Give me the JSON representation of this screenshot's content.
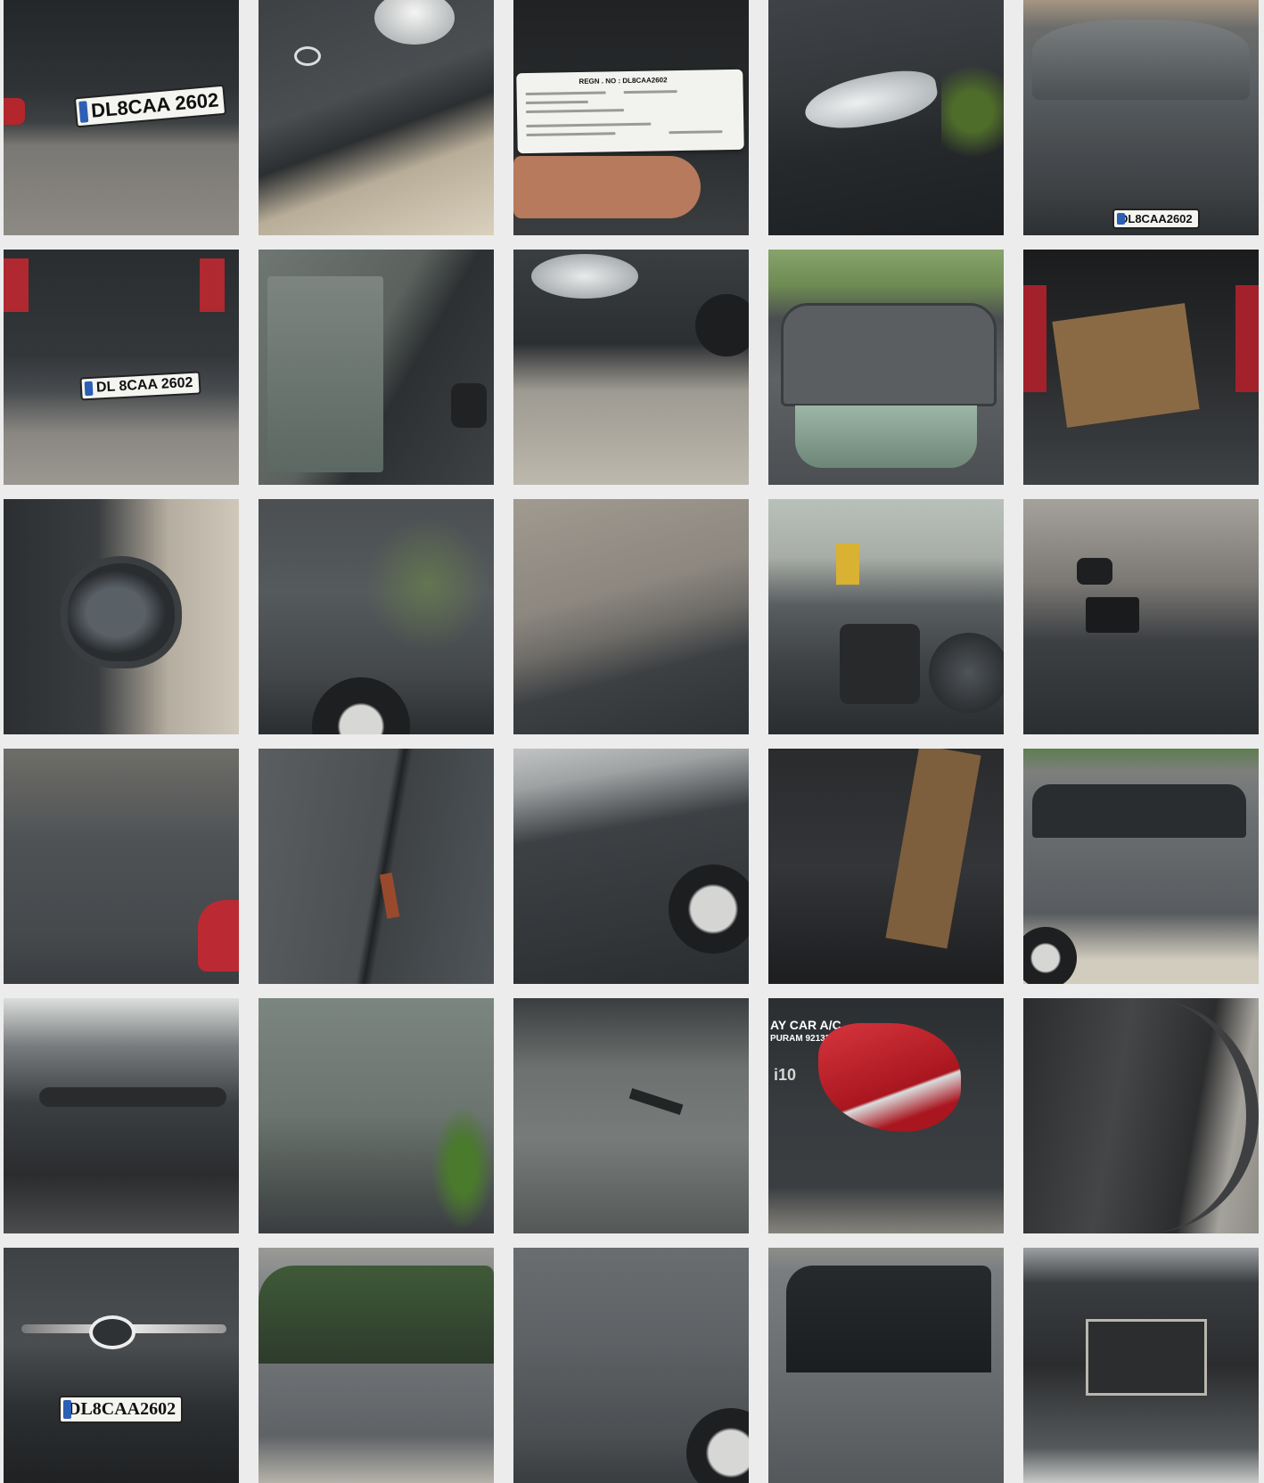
{
  "gallery": {
    "photos": [
      {
        "plate": "DL8CAA 2602"
      },
      {
        "plate": ""
      },
      {
        "card_title": "REGN . NO : DL8CAA2602",
        "card_regn": "DL8CAA2602"
      },
      {},
      {
        "plate": "DL8CAA2602"
      },
      {
        "plate": "DL 8CAA 2602"
      },
      {},
      {},
      {},
      {},
      {},
      {},
      {},
      {},
      {},
      {},
      {},
      {},
      {},
      {},
      {},
      {},
      {},
      {
        "banner": "AY CAR A/C",
        "banner_sub": "PURAM 9213236242",
        "badge": "i10"
      },
      {},
      {
        "plate": "DL8CAA2602"
      },
      {},
      {},
      {},
      {}
    ]
  }
}
